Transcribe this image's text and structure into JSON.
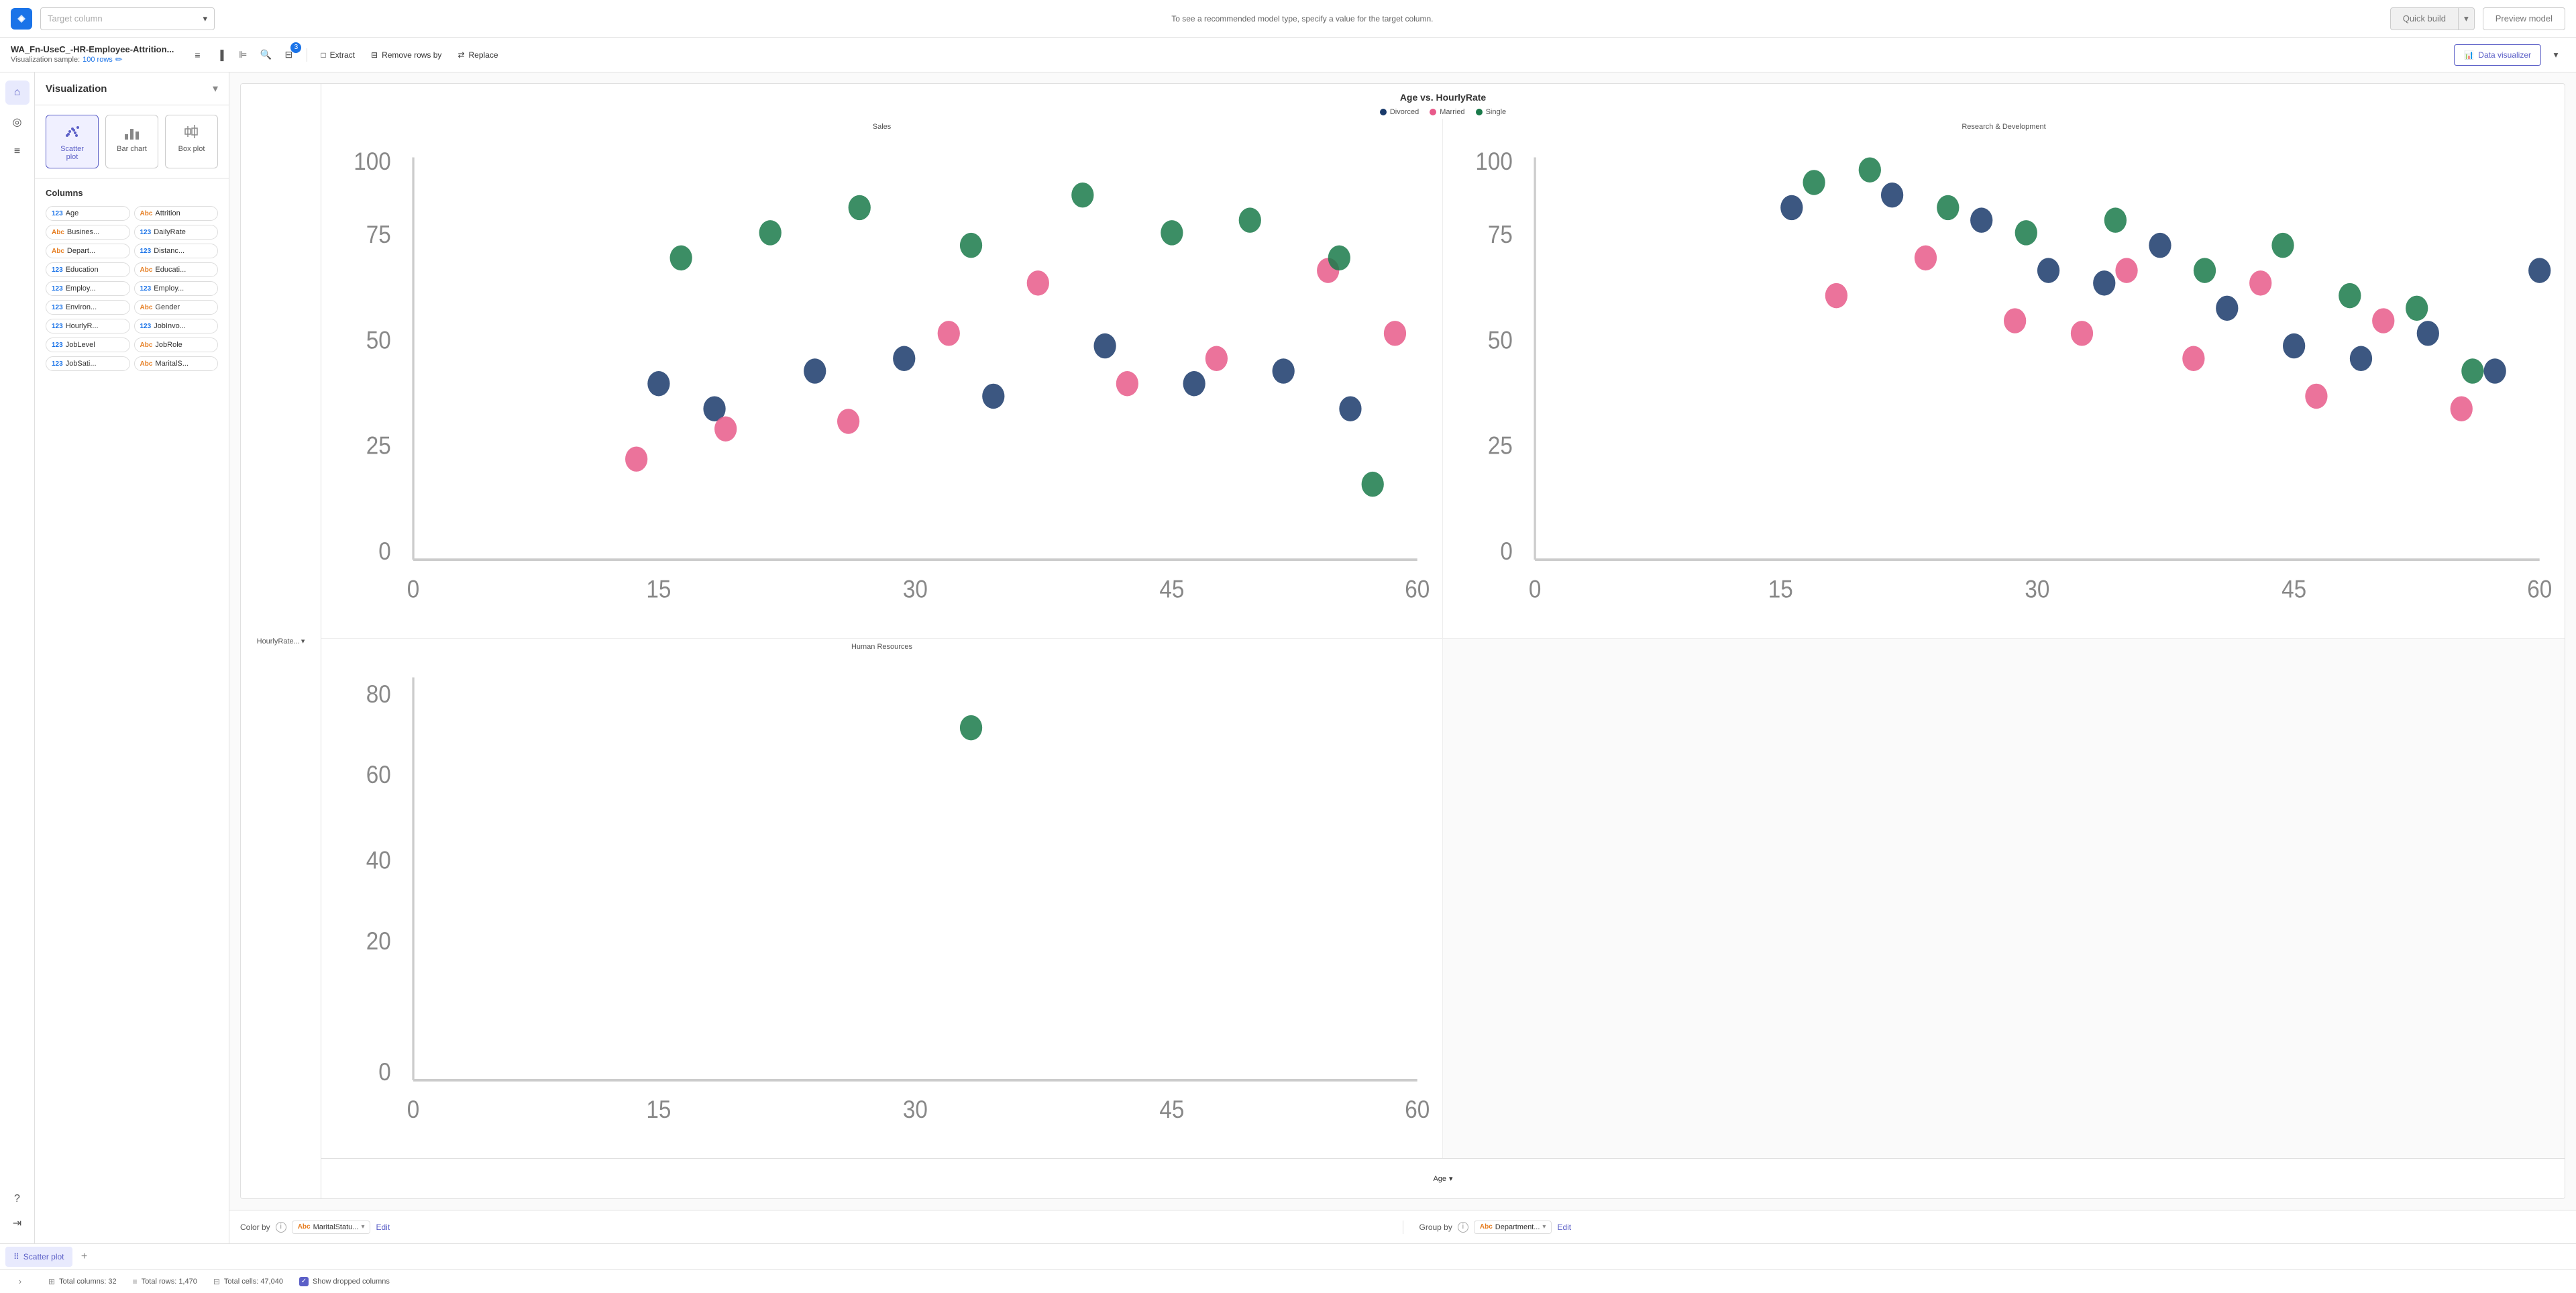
{
  "topBar": {
    "targetColumnPlaceholder": "Target column",
    "hint": "To see a recommended model type, specify a value for the target column.",
    "quickBuildLabel": "Quick build",
    "previewModelLabel": "Preview model"
  },
  "secondBar": {
    "fileName": "WA_Fn-UseC_-HR-Employee-Attrition...",
    "vizSample": "Visualization sample:",
    "rowCount": "100 rows",
    "extractLabel": "Extract",
    "removeRowsByLabel": "Remove rows by",
    "replaceLabel": "Replace",
    "dataVizLabel": "Data visualizer"
  },
  "sidebar": {
    "title": "Visualization",
    "vizTypes": [
      {
        "id": "scatter",
        "label": "Scatter plot",
        "icon": "⠿"
      },
      {
        "id": "bar",
        "label": "Bar chart",
        "icon": "▐"
      },
      {
        "id": "box",
        "label": "Box plot",
        "icon": "⊞"
      }
    ],
    "columnsTitle": "Columns",
    "columns": [
      {
        "type": "123",
        "typeClass": "num",
        "name": "Age"
      },
      {
        "type": "Abc",
        "typeClass": "str",
        "name": "Attrition"
      },
      {
        "type": "Abc",
        "typeClass": "str",
        "name": "Busines..."
      },
      {
        "type": "123",
        "typeClass": "num",
        "name": "DailyRate"
      },
      {
        "type": "Abc",
        "typeClass": "str",
        "name": "Depart..."
      },
      {
        "type": "123",
        "typeClass": "num",
        "name": "Distanc..."
      },
      {
        "type": "123",
        "typeClass": "num",
        "name": "Education"
      },
      {
        "type": "Abc",
        "typeClass": "str",
        "name": "Educati..."
      },
      {
        "type": "123",
        "typeClass": "num",
        "name": "Employ..."
      },
      {
        "type": "123",
        "typeClass": "num",
        "name": "Employ..."
      },
      {
        "type": "123",
        "typeClass": "num",
        "name": "Environ..."
      },
      {
        "type": "Abc",
        "typeClass": "str",
        "name": "Gender"
      },
      {
        "type": "123",
        "typeClass": "num",
        "name": "HourlyR..."
      },
      {
        "type": "123",
        "typeClass": "num",
        "name": "JobInvo..."
      },
      {
        "type": "123",
        "typeClass": "num",
        "name": "JobLevel"
      },
      {
        "type": "Abc",
        "typeClass": "str",
        "name": "JobRole"
      },
      {
        "type": "123",
        "typeClass": "num",
        "name": "JobSati..."
      },
      {
        "type": "Abc",
        "typeClass": "str",
        "name": "MaritalS..."
      }
    ]
  },
  "chart": {
    "title": "Age vs. HourlyRate",
    "legend": [
      {
        "id": "divorced",
        "label": "Divorced",
        "color": "#1a3a6b"
      },
      {
        "id": "married",
        "label": "Married",
        "color": "#e85a8a"
      },
      {
        "id": "single",
        "label": "Single",
        "color": "#1a7a4a"
      }
    ],
    "subplots": [
      {
        "id": "sales",
        "title": "Sales",
        "col": 0,
        "row": 0
      },
      {
        "id": "research",
        "title": "Research & Development",
        "col": 1,
        "row": 0
      },
      {
        "id": "hr",
        "title": "Human Resources",
        "col": 0,
        "row": 1
      },
      {
        "id": "empty",
        "title": "",
        "col": 1,
        "row": 1
      }
    ],
    "yAxisLabel": "HourlyRate...",
    "xAxisLabel": "Age",
    "xRange": "0 - 60",
    "yRange": "0 - 100"
  },
  "colorBy": {
    "label": "Color by",
    "value": "MaritalStatu...",
    "editLabel": "Edit"
  },
  "groupBy": {
    "label": "Group by",
    "value": "Department...",
    "editLabel": "Edit"
  },
  "tabs": [
    {
      "id": "scatter",
      "label": "Scatter plot",
      "active": true
    }
  ],
  "statusBar": {
    "totalColumns": "Total columns: 32",
    "totalRows": "Total rows: 1,470",
    "totalCells": "Total cells: 47,040",
    "showDroppedLabel": "Show dropped columns"
  }
}
